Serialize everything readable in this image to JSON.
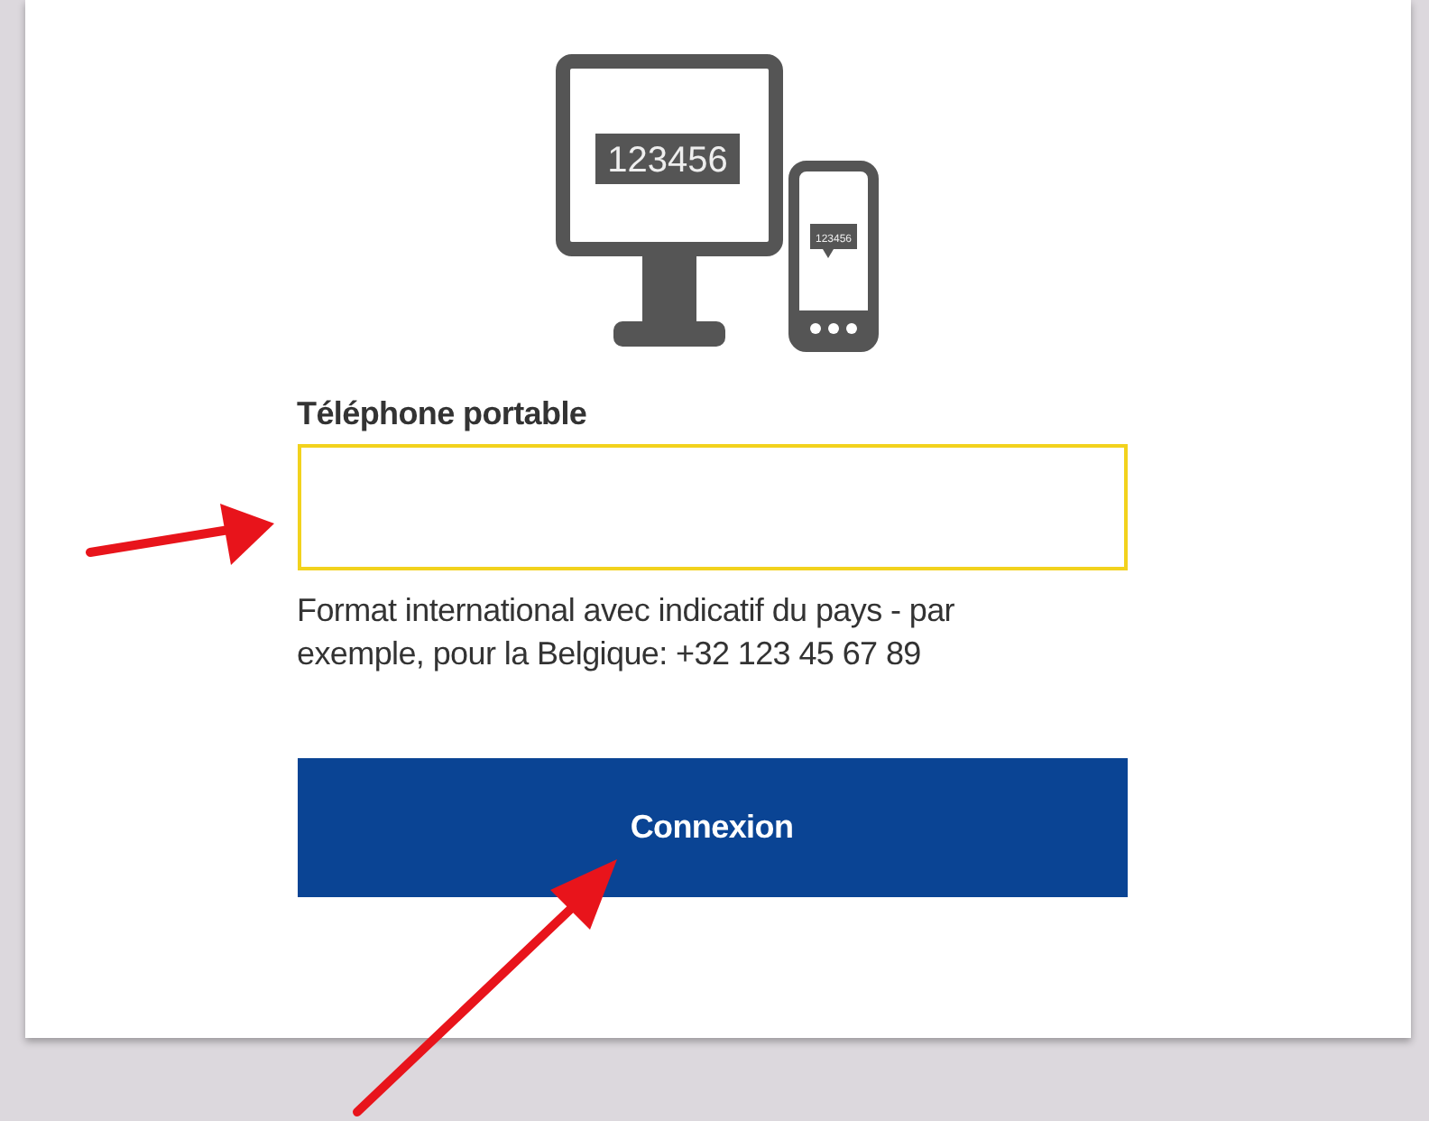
{
  "illustration": {
    "monitor_code": "123456",
    "phone_code": "123456"
  },
  "phone_field": {
    "label": "Téléphone portable",
    "focused": true
  },
  "help_text": "Format international avec indicatif du pays - par exemple, pour la Belgique: +32 123 45 67 89",
  "submit_button": {
    "label": "Connexion"
  }
}
